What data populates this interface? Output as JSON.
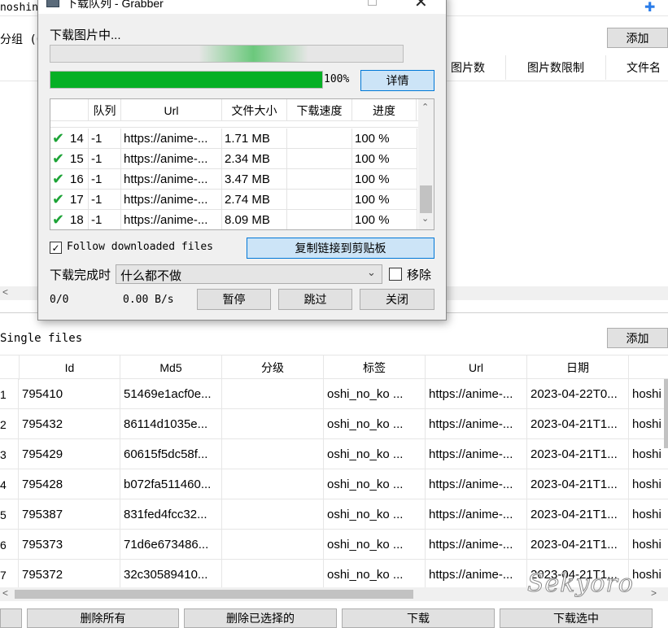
{
  "background": {
    "window_title_fragment": "noshin",
    "group_label": "分组 (0",
    "top_add_button": "添加",
    "group_columns": [
      "图片数",
      "图片数限制",
      "文件名"
    ],
    "single_files_label": "Single files",
    "single_add_button": "添加",
    "table": {
      "headers": [
        "Id",
        "Md5",
        "分级",
        "标签",
        "Url",
        "日期"
      ],
      "rows": [
        {
          "num": "1",
          "id": "795410",
          "md5": "51469e1acf0e...",
          "rating": "",
          "tags": "oshi_no_ko ...",
          "url": "https://anime-...",
          "date": "2023-04-22T0...",
          "extra": "hoshi"
        },
        {
          "num": "2",
          "id": "795432",
          "md5": "86114d1035e...",
          "rating": "",
          "tags": "oshi_no_ko ...",
          "url": "https://anime-...",
          "date": "2023-04-21T1...",
          "extra": "hoshi"
        },
        {
          "num": "3",
          "id": "795429",
          "md5": "60615f5dc58f...",
          "rating": "",
          "tags": "oshi_no_ko ...",
          "url": "https://anime-...",
          "date": "2023-04-21T1...",
          "extra": "hoshi"
        },
        {
          "num": "4",
          "id": "795428",
          "md5": "b072fa511460...",
          "rating": "",
          "tags": "oshi_no_ko ...",
          "url": "https://anime-...",
          "date": "2023-04-21T1...",
          "extra": "hoshi"
        },
        {
          "num": "5",
          "id": "795387",
          "md5": "831fed4fcc32...",
          "rating": "",
          "tags": "oshi_no_ko ...",
          "url": "https://anime-...",
          "date": "2023-04-21T1...",
          "extra": "hoshi"
        },
        {
          "num": "6",
          "id": "795373",
          "md5": "71d6e673486...",
          "rating": "",
          "tags": "oshi_no_ko ...",
          "url": "https://anime-...",
          "date": "2023-04-21T1...",
          "extra": "hoshi"
        },
        {
          "num": "7",
          "id": "795372",
          "md5": "32c30589410...",
          "rating": "",
          "tags": "oshi_no_ko ...",
          "url": "https://anime-...",
          "date": "2023-04-21T1...",
          "extra": "hoshi"
        }
      ]
    },
    "bottom_buttons": [
      "删除所有",
      "删除已选择的",
      "下载",
      "下载选中"
    ],
    "watermark": "Sekyoro"
  },
  "dialog": {
    "title": "下载队列 - Grabber",
    "status_label": "下载图片中...",
    "overall_progress_percent": 100,
    "overall_progress_text": "100%",
    "details_button": "详情",
    "queue": {
      "headers": [
        "队列",
        "Url",
        "文件大小",
        "下载速度",
        "进度"
      ],
      "rows": [
        {
          "num": "14",
          "queue": "-1",
          "url": "https://anime-...",
          "size": "1.71 MB",
          "speed": "",
          "progress": "100 %"
        },
        {
          "num": "15",
          "queue": "-1",
          "url": "https://anime-...",
          "size": "2.34 MB",
          "speed": "",
          "progress": "100 %"
        },
        {
          "num": "16",
          "queue": "-1",
          "url": "https://anime-...",
          "size": "3.47 MB",
          "speed": "",
          "progress": "100 %"
        },
        {
          "num": "17",
          "queue": "-1",
          "url": "https://anime-...",
          "size": "2.74 MB",
          "speed": "",
          "progress": "100 %"
        },
        {
          "num": "18",
          "queue": "-1",
          "url": "https://anime-...",
          "size": "8.09 MB",
          "speed": "",
          "progress": "100 %"
        }
      ]
    },
    "follow_checkbox_label": "Follow downloaded files",
    "follow_checked": true,
    "copy_links_button": "复制链接到剪贴板",
    "on_finish_label": "下载完成时",
    "on_finish_value": "什么都不做",
    "remove_checkbox_label": "移除",
    "remove_checked": false,
    "counter": "0/0",
    "speed": "0.00 B/s",
    "pause_button": "暂停",
    "skip_button": "跳过",
    "close_button": "关闭"
  },
  "colors": {
    "progress_green": "#06b025",
    "check_green": "#1ca336",
    "accent_blue": "#0078d7"
  }
}
